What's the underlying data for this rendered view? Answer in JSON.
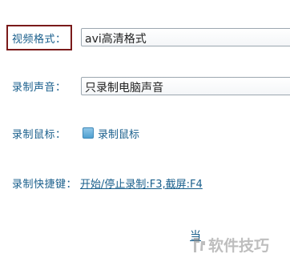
{
  "video_format": {
    "label": "视频格式：",
    "value": "avi高清格式"
  },
  "audio_record": {
    "label": "录制声音：",
    "value": "只录制电脑声音"
  },
  "mouse_record": {
    "label": "录制鼠标：",
    "checkbox_label": "录制鼠标",
    "checked": true
  },
  "hotkeys": {
    "label": "录制快捷键：",
    "value": "开始/停止录制:F3,截屏:F4"
  },
  "partial_text": "当",
  "watermark": {
    "text": "软件技巧"
  },
  "colors": {
    "label": "#1a5f8c",
    "highlight_border": "#7a1a1a",
    "checkbox": "#4fa0d0"
  }
}
